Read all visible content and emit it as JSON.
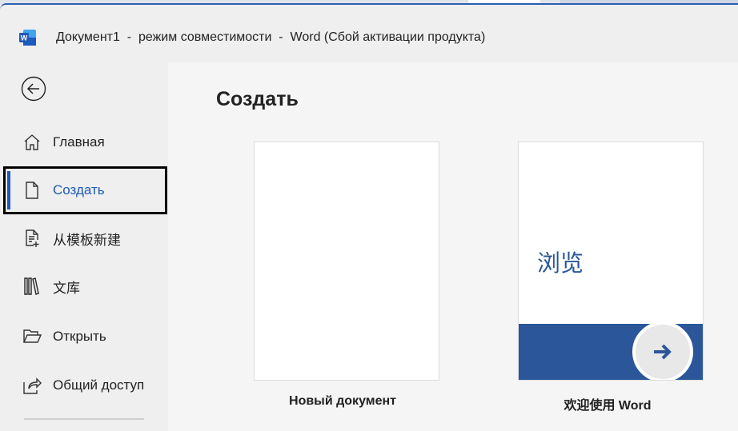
{
  "window": {
    "title": "Документ1  -  режим совместимости  -  Word (Сбой активации продукта)"
  },
  "sidebar": {
    "items": [
      {
        "label": "Главная",
        "icon": "home-icon"
      },
      {
        "label": "Создать",
        "icon": "new-document-icon",
        "active": true
      },
      {
        "label": "从模板新建",
        "icon": "template-icon"
      },
      {
        "label": "文库",
        "icon": "library-icon"
      },
      {
        "label": "Открыть",
        "icon": "folder-open-icon"
      },
      {
        "label": "Общий доступ",
        "icon": "share-icon"
      }
    ]
  },
  "main": {
    "heading": "Создать",
    "templates": [
      {
        "caption": "Новый документ"
      },
      {
        "caption": "欢迎使用 Word",
        "preview_text": "浏览"
      }
    ]
  },
  "colors": {
    "accent": "#1f58b4",
    "brand": "#2b579a"
  }
}
